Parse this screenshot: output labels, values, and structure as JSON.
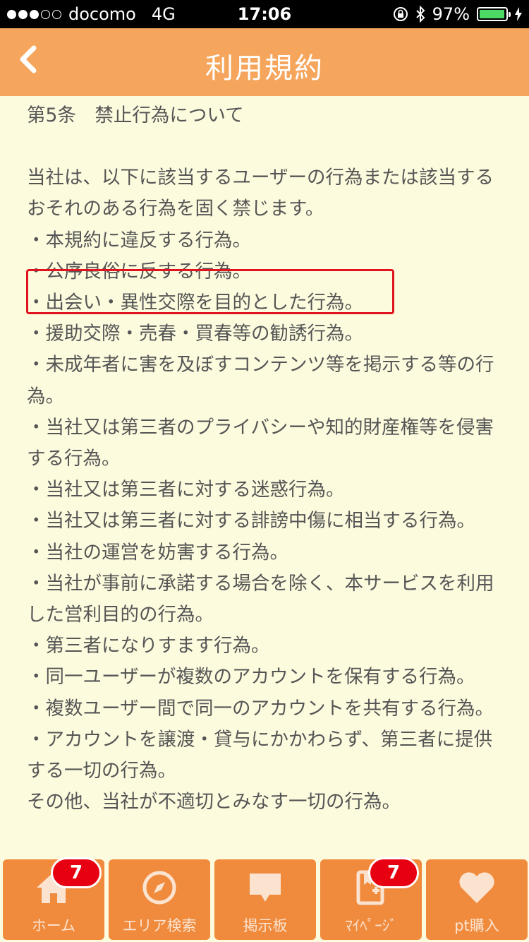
{
  "status_bar": {
    "carrier": "docomo",
    "network": "4G",
    "time": "17:06",
    "battery_percent": "97%",
    "battery_level": 0.97
  },
  "nav": {
    "title": "利用規約"
  },
  "content": {
    "heading": "第5条　禁止行為について",
    "paragraphs": [
      "当社は、以下に該当するユーザーの行為または該当するおそれのある行為を固く禁じます。",
      "・本規約に違反する行為。",
      "・公序良俗に反する行為。",
      "・出会い・異性交際を目的とした行為。",
      "・援助交際・売春・買春等の勧誘行為。",
      "・未成年者に害を及ぼすコンテンツ等を掲示する等の行為。",
      "・当社又は第三者のプライバシーや知的財産権等を侵害する行為。",
      "・当社又は第三者に対する迷惑行為。",
      "・当社又は第三者に対する誹謗中傷に相当する行為。",
      "・当社の運営を妨害する行為。",
      "・当社が事前に承諾する場合を除く、本サービスを利用した営利目的の行為。",
      "・第三者になりすます行為。",
      "・同一ユーザーが複数のアカウントを保有する行為。",
      "・複数ユーザー間で同一のアカウントを共有する行為。",
      "・アカウントを譲渡・貸与にかかわらず、第三者に提供する一切の行為。",
      "その他、当社が不適切とみなす一切の行為。"
    ]
  },
  "tabs": [
    {
      "label": "ホーム",
      "icon": "home-icon",
      "badge": "7"
    },
    {
      "label": "エリア検索",
      "icon": "compass-icon"
    },
    {
      "label": "掲示板",
      "icon": "speech-bubble-icon"
    },
    {
      "label": "ﾏｲﾍﾟｰｼﾞ",
      "icon": "bookmark-book-icon",
      "badge": "7"
    },
    {
      "label": "pt購入",
      "icon": "heart-icon"
    }
  ],
  "colors": {
    "nav_bg": "#f5a55c",
    "page_bg": "#fdfbde",
    "tab_bg": "#f08a3c",
    "badge_bg": "#e60012",
    "highlight": "#e0141e"
  }
}
